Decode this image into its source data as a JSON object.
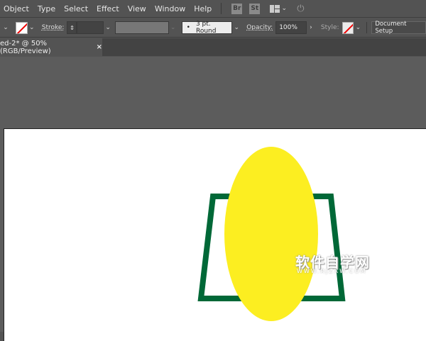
{
  "menu": [
    "Object",
    "Type",
    "Select",
    "Effect",
    "View",
    "Window",
    "Help"
  ],
  "app_icons": {
    "bridge": "Br",
    "stock": "St"
  },
  "control": {
    "stroke_label": "Stroke:",
    "brush": "3 pt. Round",
    "opacity_label": "Opacity:",
    "opacity": "100%",
    "style_label": "Style:",
    "doc_setup": "Document Setup"
  },
  "tab": {
    "title": "ed-2* @ 50% (RGB/Preview)",
    "close": "×"
  },
  "watermark": {
    "cn": "软件自学网",
    "url": "WWW.RJZXW.COM"
  },
  "colors": {
    "ellipse": "#fcee21",
    "trapezoid": "#006837"
  }
}
